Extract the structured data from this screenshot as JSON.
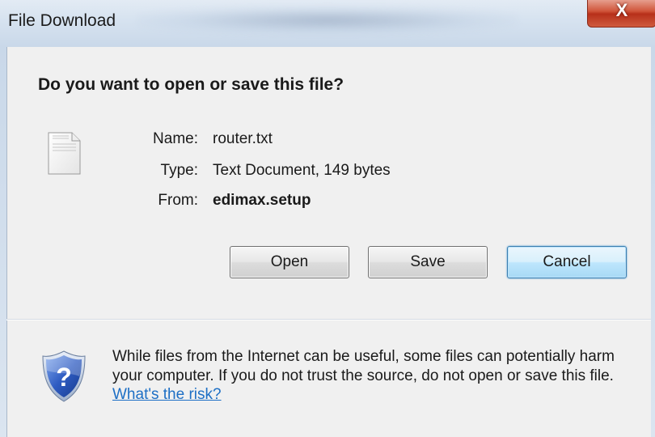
{
  "window": {
    "title": "File Download",
    "close_glyph": "X"
  },
  "dialog": {
    "question": "Do you want to open or save this file?",
    "file_icon": "text-file-icon",
    "fields": {
      "name_label": "Name:",
      "name_value": "router.txt",
      "type_label": "Type:",
      "type_value": "Text Document, 149 bytes",
      "from_label": "From:",
      "from_value": "edimax.setup"
    },
    "buttons": {
      "open": "Open",
      "save": "Save",
      "cancel": "Cancel"
    }
  },
  "warning": {
    "icon": "shield-question-icon",
    "text": "While files from the Internet can be useful, some files can potentially harm your computer. If you do not trust the source, do not open or save this file.",
    "link": "What's the risk?"
  },
  "colors": {
    "link": "#1d6fc5",
    "default_button_border": "#3c7fb1",
    "shield_blue": "#2a4fa8"
  }
}
